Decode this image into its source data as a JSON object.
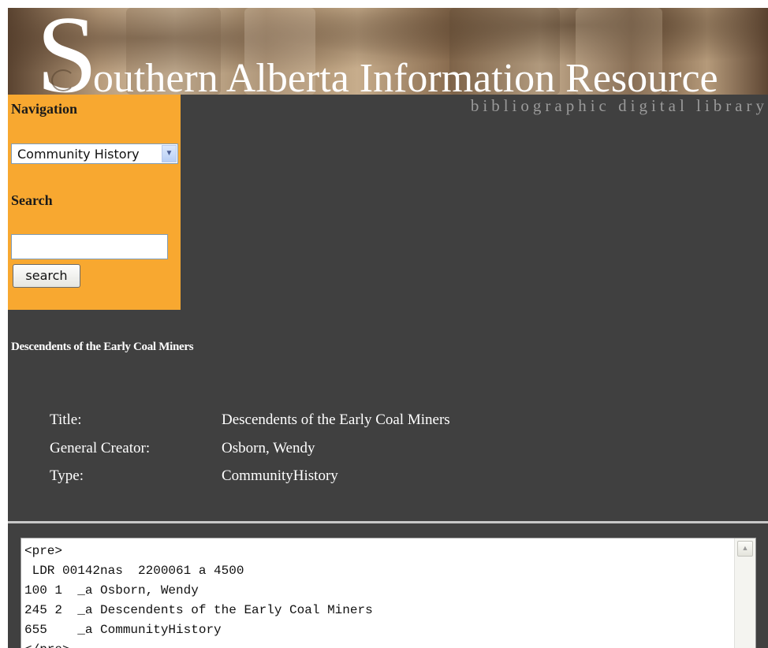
{
  "banner": {
    "title_initial": "S",
    "title_rest": "outhern Alberta Information Resource",
    "subtitle": "bibliographic digital library"
  },
  "sidebar": {
    "navigation_heading": "Navigation",
    "navigation_select": {
      "selected": "Community History",
      "arrow_icon": "chevron-down-icon"
    },
    "search_heading": "Search",
    "search_input": {
      "value": "",
      "placeholder": ""
    },
    "search_button_label": "search"
  },
  "record": {
    "heading": "Descendents of the Early Coal Miners",
    "fields": [
      {
        "label": "Title:",
        "value": "Descendents of the Early Coal Miners"
      },
      {
        "label": "General Creator:",
        "value": "Osborn, Wendy"
      },
      {
        "label": "Type:",
        "value": "CommunityHistory"
      }
    ]
  },
  "marc": {
    "lines": [
      "<pre>",
      " LDR 00142nas  2200061 a 4500",
      "100 1  _a Osborn, Wendy",
      "245 2  _a Descendents of the Early Coal Miners",
      "655    _a CommunityHistory",
      "</pre>"
    ],
    "scroll_icon": "scroll-up-arrow-icon"
  },
  "colors": {
    "sidebar": "#f8a830",
    "background": "#404040",
    "text_light": "#ffffff",
    "subtitle": "#9a9a9a"
  }
}
